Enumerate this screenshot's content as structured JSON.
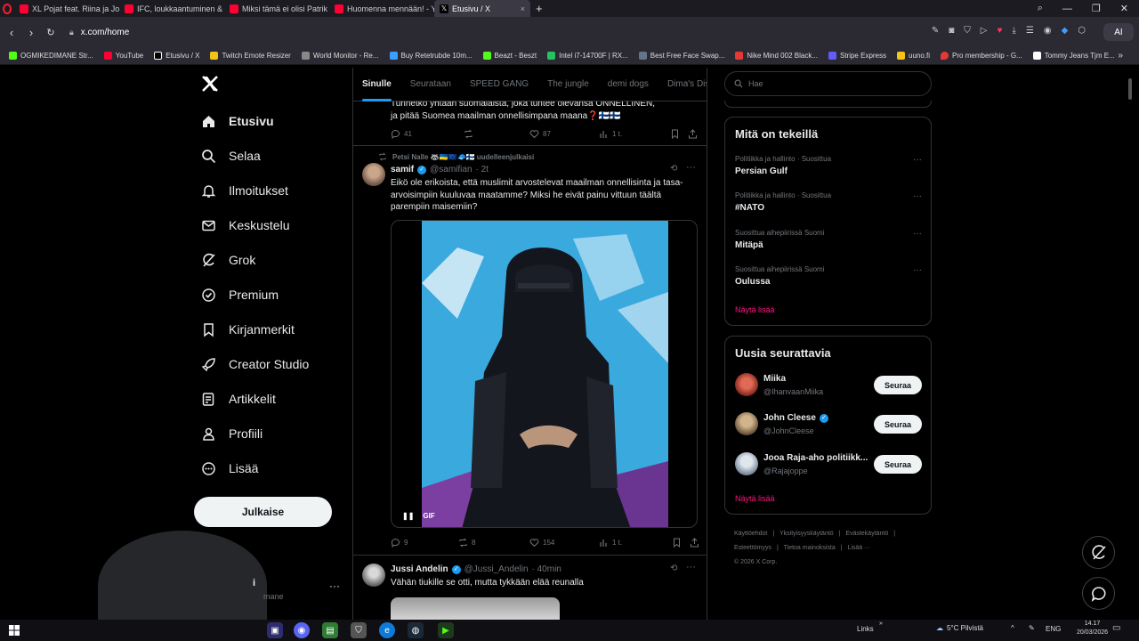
{
  "browser": {
    "tabs": [
      {
        "label": "XL Pojat feat. Riina ja Joni",
        "color": "#ff0033",
        "active": false
      },
      {
        "label": "IFC, loukkaantuminen & V",
        "color": "#ff0033",
        "active": false
      },
      {
        "label": "Miksi tämä ei olisi Patrik L",
        "color": "#ff0033",
        "active": false
      },
      {
        "label": "Huomenna mennään! - Yo",
        "color": "#ff0033",
        "active": false
      },
      {
        "label": "Etusivu / X",
        "color": "#ffffff",
        "active": true
      }
    ],
    "new_tab": "+",
    "url": "x.com/home",
    "ai_label": "AI",
    "bookmarks": [
      {
        "label": "OGMIKEDIMANE Str...",
        "color": "#53fc18"
      },
      {
        "label": "YouTube",
        "color": "#ff0033"
      },
      {
        "label": "Etusivu / X",
        "color": "#ffffff"
      },
      {
        "label": "Twitch Emote Resizer",
        "color": "#f0c419"
      },
      {
        "label": "World Monitor - Re...",
        "color": "#888888"
      },
      {
        "label": "Buy Retetrubde 10m...",
        "color": "#3aa0ff"
      },
      {
        "label": "Beazt - Beszt",
        "color": "#53fc18"
      },
      {
        "label": "Intel i7-14700F | RX...",
        "color": "#22c55e"
      },
      {
        "label": "Best Free Face Swap...",
        "color": "#64748b"
      },
      {
        "label": "Nike Mind 002 Black...",
        "color": "#e53935"
      },
      {
        "label": "Stripe Express",
        "color": "#635bff"
      },
      {
        "label": "uuno.fi",
        "color": "#f5c518"
      },
      {
        "label": "Pro membership - G...",
        "color": "#e53935"
      },
      {
        "label": "Tommy Jeans Tjm E...",
        "color": "#ffffff"
      }
    ]
  },
  "nav": {
    "items": [
      {
        "label": "Etusivu",
        "icon": "home-icon"
      },
      {
        "label": "Selaa",
        "icon": "search-icon"
      },
      {
        "label": "Ilmoitukset",
        "icon": "bell-icon"
      },
      {
        "label": "Keskustelu",
        "icon": "mail-icon"
      },
      {
        "label": "Grok",
        "icon": "grok-icon"
      },
      {
        "label": "Premium",
        "icon": "premium-icon"
      },
      {
        "label": "Kirjanmerkit",
        "icon": "bookmark-icon"
      },
      {
        "label": "Creator Studio",
        "icon": "rocket-icon"
      },
      {
        "label": "Artikkelit",
        "icon": "article-icon"
      },
      {
        "label": "Profiili",
        "icon": "person-icon"
      },
      {
        "label": "Lisää",
        "icon": "more-circle-icon"
      }
    ],
    "post_button": "Julkaise",
    "account_name": "i",
    "account_handle": "mane",
    "account_more": "···"
  },
  "feed": {
    "tabs": [
      "Sinulle",
      "Seurataan",
      "SPEED GANG",
      "The jungle",
      "demi dogs",
      "Dima's Dist"
    ],
    "partial_tweet": {
      "text_line1": "Tunnetko yhtään suomalaista, joka tuntee olevansa ONNELLINEN,",
      "text_line2": "ja pitää Suomea maailman onnellisimpana maana❓🇫🇮🇫🇮",
      "replies": "41",
      "reposts": "",
      "likes": "87",
      "views": "1 t."
    },
    "tweet": {
      "reposted_by": "Petsi Nalle 🦝🇺🇦🇪🇺🧢🇫🇮 uudelleenjulkaisi",
      "name": "samif",
      "handle": "@samifian",
      "time": "· 2t",
      "text": "Eikö ole erikoista, että muslimit arvostelevat maailman onnellisinta ja tasa-arvoisimpiin kuuluvaa maatamme? Miksi he eivät painu vittuun täältä parempiin maisemiin?",
      "gif_label": "GIF",
      "pause_icon": "pause-icon",
      "replies": "9",
      "reposts": "8",
      "likes": "154",
      "views": "1 t."
    },
    "next_tweet": {
      "name": "Jussi Andelin",
      "handle": "@Jussi_Andelin",
      "time": "· 40min",
      "text": "Vähän tiukille se otti, mutta tykkään elää reunalla"
    }
  },
  "sidebar": {
    "search_placeholder": "Hae",
    "trends_title": "Mitä on tekeillä",
    "trends": [
      {
        "meta": "Politiikka ja hallinto · Suosittua",
        "name": "Persian Gulf"
      },
      {
        "meta": "Politiikka ja hallinto · Suosittua",
        "name": "#NATO"
      },
      {
        "meta": "Suosittua aihepiirissä Suomi",
        "name": "Mitäpä"
      },
      {
        "meta": "Suosittua aihepiirissä Suomi",
        "name": "Oulussa"
      }
    ],
    "trends_show_more": "Näytä lisää",
    "follow_title": "Uusia seurattavia",
    "follow": [
      {
        "name": "Miika",
        "handle": "@IhanvaanMiika",
        "button": "Seuraa",
        "color": "#b3332f"
      },
      {
        "name": "John Cleese",
        "handle": "@JohnCleese",
        "button": "Seuraa",
        "color": "#8a6d4b"
      },
      {
        "name": "Jooa Raja-aho politiikk...",
        "handle": "@Rajajoppe",
        "button": "Seuraa",
        "color": "#9aa7b5"
      }
    ],
    "follow_show_more": "Näytä lisää",
    "footer": [
      "Käyttöehdot",
      "|",
      "Yksityisyyskäytäntö",
      "|",
      "Evästekäytäntö",
      "|",
      "Esteettömyys",
      "|",
      "Tietoa mainoksista",
      "|",
      "Lisää ···",
      "© 2026 X Corp."
    ]
  },
  "taskbar": {
    "links": "Links",
    "weather": "5°C  Pilvistä",
    "lang": "ENG",
    "time": "14.17",
    "date": "20/03/2026"
  }
}
